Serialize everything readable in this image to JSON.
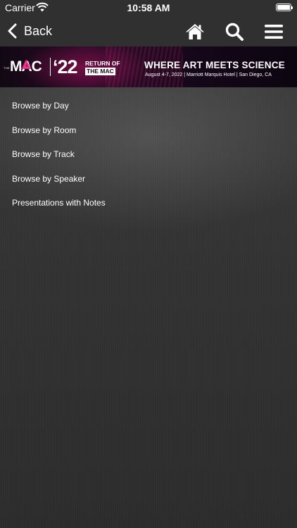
{
  "status_bar": {
    "carrier": "Carrier",
    "time": "10:58 AM"
  },
  "nav": {
    "back_label": "Back",
    "icons": [
      "home-icon",
      "search-icon",
      "menu-icon"
    ]
  },
  "banner": {
    "logo_prefix": "THE",
    "logo_name": "MAC",
    "year": "‘22",
    "tagline_top": "RETURN OF",
    "tagline_bottom": "THE MAC",
    "headline": "WHERE ART MEETS SCIENCE",
    "subline": "August 4-7, 2022 | Marriott Marquis Hotel | San Diego, CA"
  },
  "menu": {
    "items": [
      {
        "label": "Browse by Day"
      },
      {
        "label": "Browse by Room"
      },
      {
        "label": "Browse by Track"
      },
      {
        "label": "Browse by Speaker"
      },
      {
        "label": "Presentations with Notes"
      }
    ]
  },
  "colors": {
    "bar_background": "#303030",
    "accent_pink": "#e0177a",
    "text": "#ffffff"
  }
}
